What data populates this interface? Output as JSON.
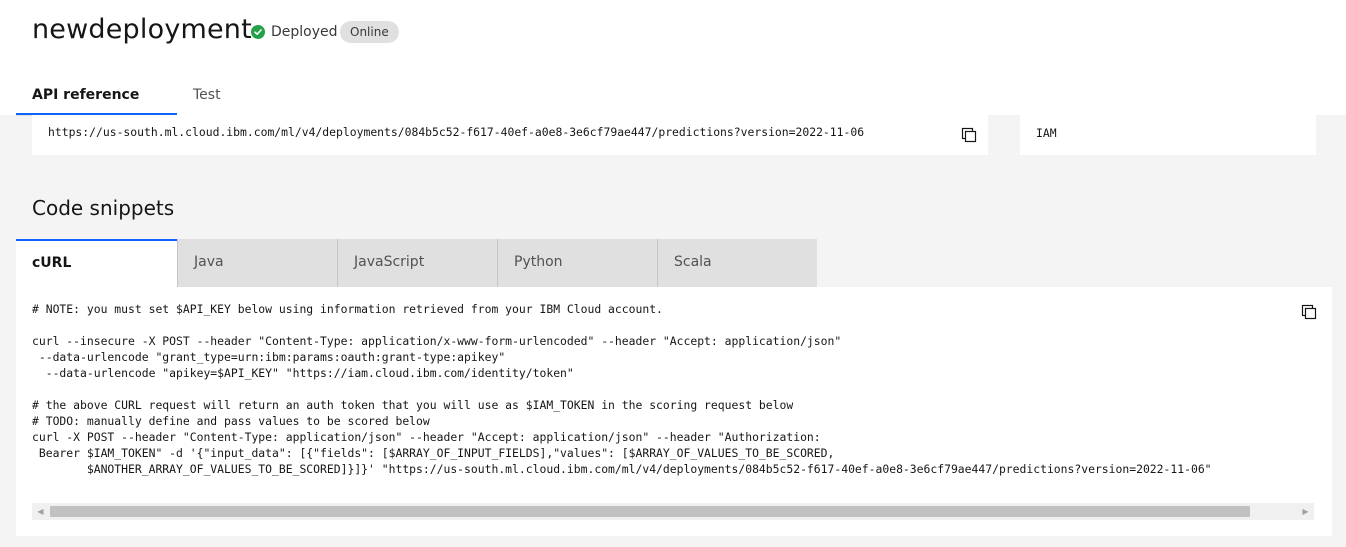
{
  "deployment": {
    "name": "newdeployment",
    "status": "Deployed",
    "badge": "Online"
  },
  "top_tabs": [
    {
      "label": "API reference",
      "active": true
    },
    {
      "label": "Test",
      "active": false
    }
  ],
  "endpoint": {
    "url": "https://us-south.ml.cloud.ibm.com/ml/v4/deployments/084b5c52-f617-40ef-a0e8-3e6cf79ae447/predictions?version=2022-11-06"
  },
  "auth": {
    "method": "IAM"
  },
  "code_snippets": {
    "title": "Code snippets",
    "tabs": [
      {
        "label": "cURL",
        "active": true
      },
      {
        "label": "Java",
        "active": false
      },
      {
        "label": "JavaScript",
        "active": false
      },
      {
        "label": "Python",
        "active": false
      },
      {
        "label": "Scala",
        "active": false
      }
    ],
    "code": "# NOTE: you must set $API_KEY below using information retrieved from your IBM Cloud account.\n\ncurl --insecure -X POST --header \"Content-Type: application/x-www-form-urlencoded\" --header \"Accept: application/json\"\n --data-urlencode \"grant_type=urn:ibm:params:oauth:grant-type:apikey\"\n  --data-urlencode \"apikey=$API_KEY\" \"https://iam.cloud.ibm.com/identity/token\"\n\n# the above CURL request will return an auth token that you will use as $IAM_TOKEN in the scoring request below\n# TODO: manually define and pass values to be scored below\ncurl -X POST --header \"Content-Type: application/json\" --header \"Accept: application/json\" --header \"Authorization:\n Bearer $IAM_TOKEN\" -d '{\"input_data\": [{\"fields\": [$ARRAY_OF_INPUT_FIELDS],\"values\": [$ARRAY_OF_VALUES_TO_BE_SCORED,\n        $ANOTHER_ARRAY_OF_VALUES_TO_BE_SCORED]}]}' \"https://us-south.ml.cloud.ibm.com/ml/v4/deployments/084b5c52-f617-40ef-a0e8-3e6cf79ae447/predictions?version=2022-11-06\""
  },
  "colors": {
    "accent": "#0f62fe",
    "success": "#24a148",
    "page_bg": "#f4f4f4"
  },
  "icons": {
    "status": "checkmark-filled-icon",
    "copy": "copy-icon",
    "scroll_left": "scroll-left-arrow-icon",
    "scroll_right": "scroll-right-arrow-icon"
  }
}
